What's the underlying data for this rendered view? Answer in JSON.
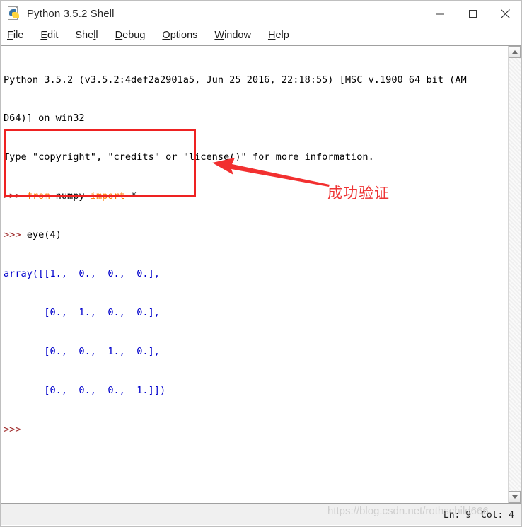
{
  "window": {
    "title": "Python 3.5.2 Shell",
    "icon": "python-idle-icon",
    "controls": {
      "minimize": "minimize-icon",
      "maximize": "maximize-icon",
      "close": "close-icon"
    }
  },
  "menu": {
    "items": [
      {
        "label": "File",
        "pre": "",
        "mnemonic": "F",
        "post": "ile"
      },
      {
        "label": "Edit",
        "pre": "",
        "mnemonic": "E",
        "post": "dit"
      },
      {
        "label": "Shell",
        "pre": "She",
        "mnemonic": "l",
        "post": "l"
      },
      {
        "label": "Debug",
        "pre": "",
        "mnemonic": "D",
        "post": "ebug"
      },
      {
        "label": "Options",
        "pre": "",
        "mnemonic": "O",
        "post": "ptions"
      },
      {
        "label": "Window",
        "pre": "",
        "mnemonic": "W",
        "post": "indow"
      },
      {
        "label": "Help",
        "pre": "",
        "mnemonic": "H",
        "post": "elp"
      }
    ]
  },
  "console": {
    "banner_line_1": "Python 3.5.2 (v3.5.2:4def2a2901a5, Jun 25 2016, 22:18:55) [MSC v.1900 64 bit (AM",
    "banner_line_2": "D64)] on win32",
    "banner_line_3": "Type \"copyright\", \"credits\" or \"license()\" for more information.",
    "prompt": ">>>",
    "input_1_kw_from": "from",
    "input_1_module": " numpy ",
    "input_1_kw_import": "import",
    "input_1_star": " *",
    "input_2": " eye(4)",
    "output_line_1": "array([[1.,  0.,  0.,  0.],",
    "output_line_2": "       [0.,  1.,  0.,  0.],",
    "output_line_3": "       [0.,  0.,  1.,  0.],",
    "output_line_4": "       [0.,  0.,  0.,  1.]])",
    "colors": {
      "prompt": "#a02c2c",
      "keyword": "#ff7700",
      "output": "#0000cc",
      "text": "#000000",
      "background": "#ffffff"
    }
  },
  "annotations": {
    "highlight_box_color": "#ee2222",
    "arrow_color": "#f23030",
    "label": "成功验证",
    "label_color": "#ee3333"
  },
  "scrollbar": {
    "up_arrow": "scroll-up-icon",
    "down_arrow": "scroll-down-icon"
  },
  "statusbar": {
    "line": "Ln: 9",
    "column": "Col: 4"
  },
  "watermark": {
    "text": "https://blog.csdn.net/rothschild666"
  }
}
